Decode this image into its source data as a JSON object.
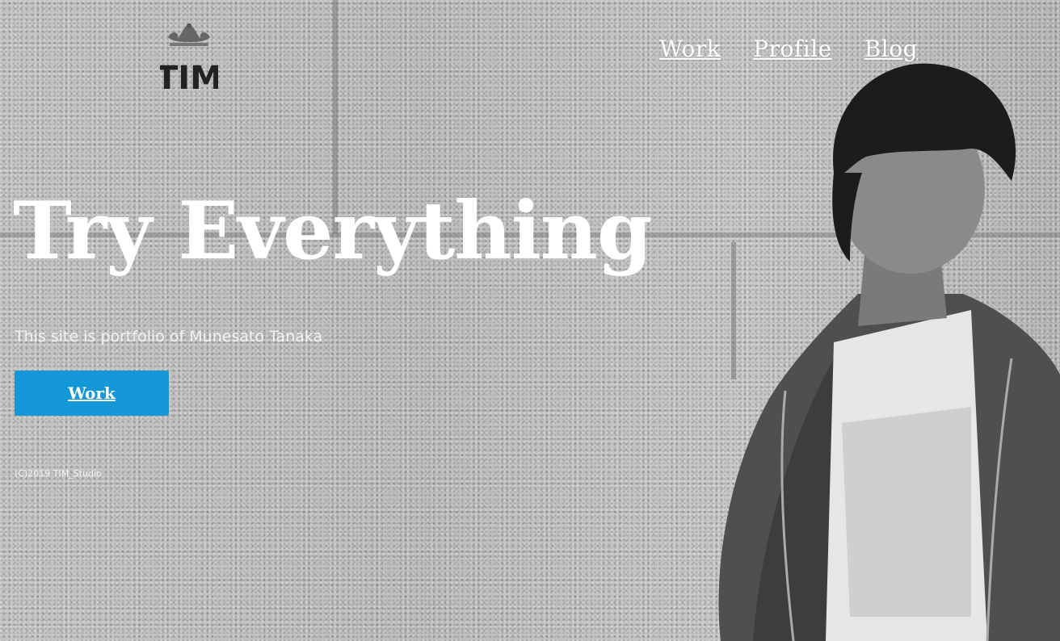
{
  "header": {
    "logo_text": "TIM",
    "nav": [
      {
        "label": "Work"
      },
      {
        "label": "Profile"
      },
      {
        "label": "Blog"
      }
    ]
  },
  "hero": {
    "title": "Try Everything",
    "subtitle": "This site is portfolio of Munesato Tanaka",
    "button_label": "Work"
  },
  "footer": {
    "copyright": "(C)2019 TIM_Studio"
  },
  "colors": {
    "accent": "#1497d6",
    "text": "#ffffff"
  },
  "icons": {
    "logo": "crown-logo-icon"
  }
}
